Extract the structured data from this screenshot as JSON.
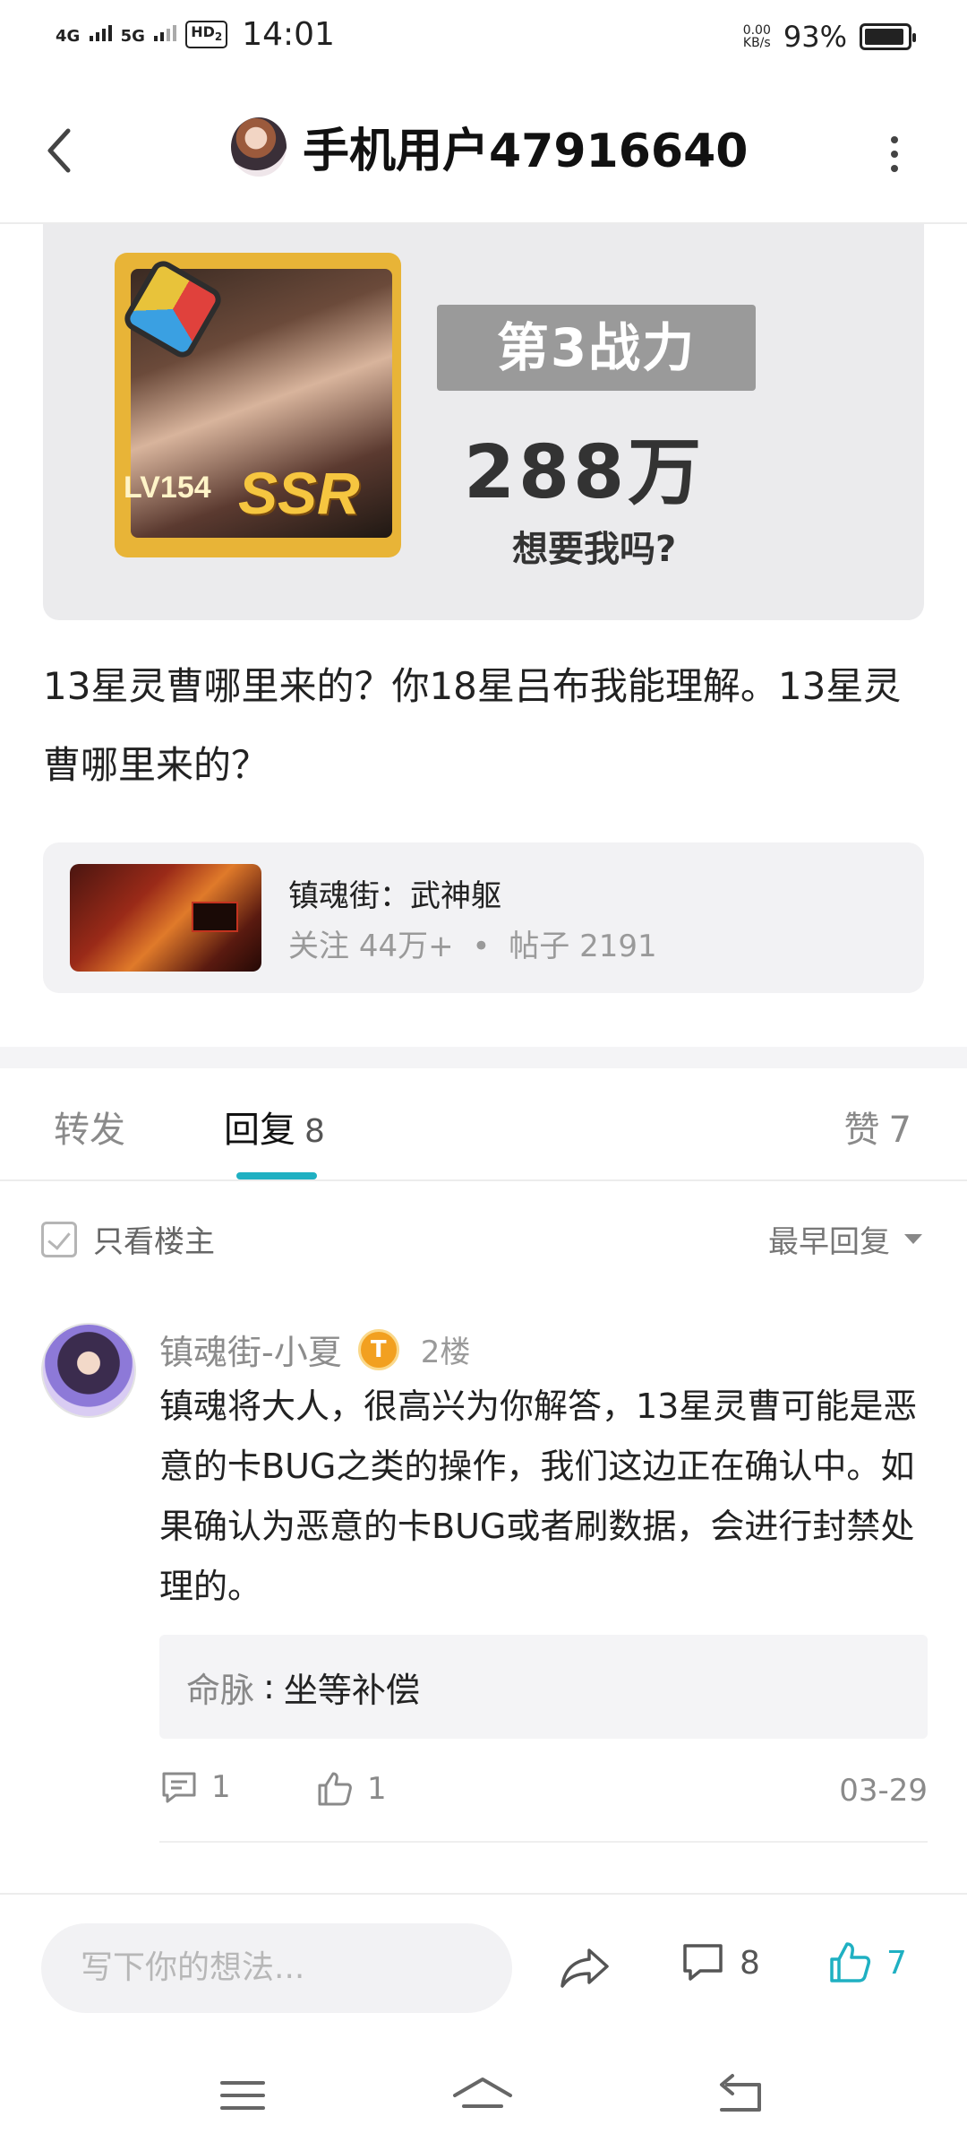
{
  "status_bar": {
    "net1": "4G",
    "net2": "5G",
    "hd": "HD",
    "hd_sub": "2",
    "time": "14:01",
    "speed_value": "0.00",
    "speed_unit": "KB/s",
    "battery": "93%",
    "battery_level": 0.93
  },
  "header": {
    "title": "手机用户47916640",
    "back_icon": "chevron-left-icon",
    "more_icon": "more-vertical-icon"
  },
  "post_image": {
    "card_level": "LV154",
    "card_rarity": "SSR",
    "rank_label": "第3战力",
    "power": "288万",
    "tagline": "想要我吗?"
  },
  "post": {
    "text": "13星灵曹哪里来的？你18星吕布我能理解。13星灵曹哪里来的？"
  },
  "forum": {
    "name": "镇魂街：武神躯",
    "follow_label": "关注",
    "follow_count": "44万+",
    "bullet": "•",
    "posts_label": "帖子",
    "posts_count": "2191"
  },
  "tabs": {
    "forward_label": "转发",
    "reply_label": "回复",
    "reply_count": "8",
    "like_label": "赞",
    "like_count": "7"
  },
  "filter": {
    "only_owner_label": "只看楼主",
    "sort_label": "最早回复"
  },
  "comment": {
    "author": "镇魂街-小夏",
    "badge": "T",
    "floor": "2楼",
    "body": "镇魂将大人，很高兴为你解答，13星灵曹可能是恶意的卡BUG之类的操作，我们这边正在确认中。如果确认为恶意的卡BUG或者刷数据，会进行封禁处理的。",
    "sub_reply": {
      "who": "命脉",
      "sep": ":",
      "text": "坐等补偿"
    },
    "reply_count": "1",
    "like_count": "1",
    "date": "03-29"
  },
  "bottom_bar": {
    "input_placeholder": "写下你的想法...",
    "comment_count": "8",
    "like_count": "7",
    "accent": "#1fb0c2"
  },
  "nav_bar": {
    "icons": [
      "menu-icon",
      "home-icon",
      "back-icon"
    ]
  }
}
